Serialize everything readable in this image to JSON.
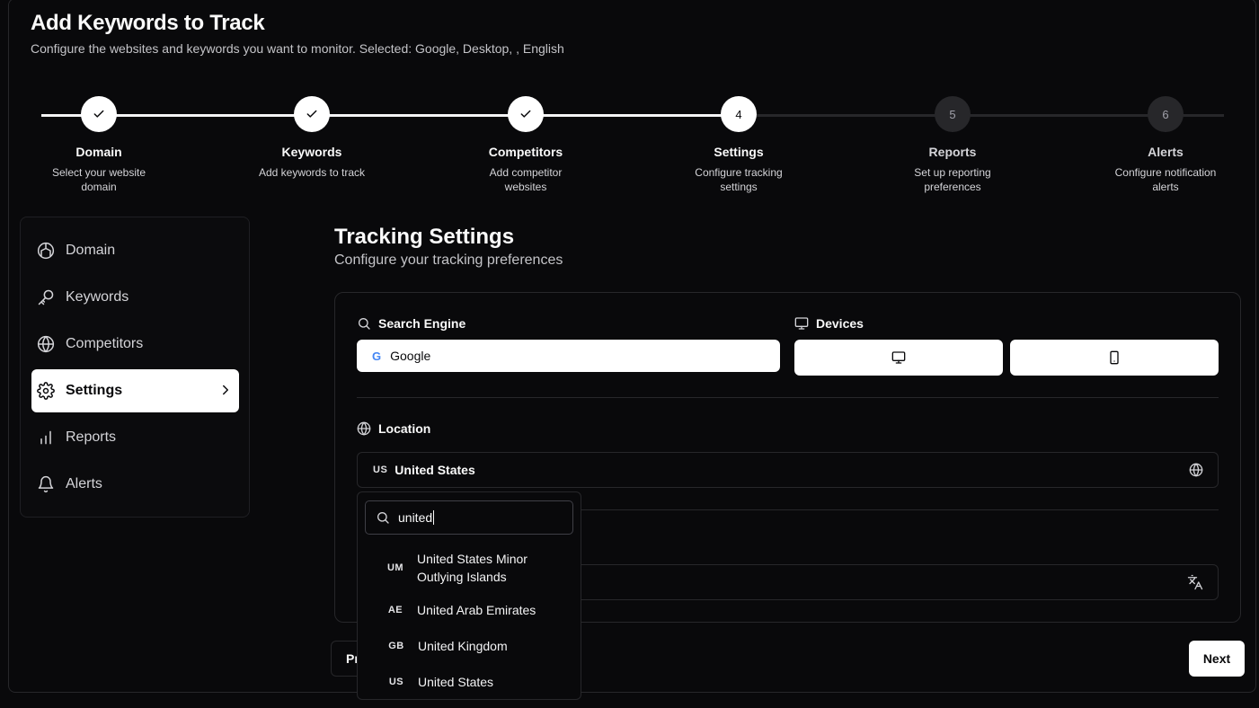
{
  "header": {
    "title": "Add Keywords to Track",
    "subtitle": "Configure the websites and keywords you want to monitor. Selected: Google, Desktop, , English"
  },
  "steps": [
    {
      "number": "1",
      "label": "Domain",
      "description": "Select your website domain",
      "state": "done"
    },
    {
      "number": "2",
      "label": "Keywords",
      "description": "Add keywords to track",
      "state": "done"
    },
    {
      "number": "3",
      "label": "Competitors",
      "description": "Add competitor websites",
      "state": "done"
    },
    {
      "number": "4",
      "label": "Settings",
      "description": "Configure tracking settings",
      "state": "current"
    },
    {
      "number": "5",
      "label": "Reports",
      "description": "Set up reporting preferences",
      "state": "todo"
    },
    {
      "number": "6",
      "label": "Alerts",
      "description": "Configure notification alerts",
      "state": "todo"
    }
  ],
  "sidebar": {
    "items": [
      {
        "label": "Domain",
        "icon": "domain-icon"
      },
      {
        "label": "Keywords",
        "icon": "key-icon"
      },
      {
        "label": "Competitors",
        "icon": "globe-icon"
      },
      {
        "label": "Settings",
        "icon": "gear-icon",
        "active": true
      },
      {
        "label": "Reports",
        "icon": "bar-chart-icon"
      },
      {
        "label": "Alerts",
        "icon": "bell-icon"
      }
    ]
  },
  "main": {
    "title": "Tracking Settings",
    "subtitle": "Configure your tracking preferences",
    "search_engine": {
      "label": "Search Engine",
      "value": "Google",
      "logo_letter": "G"
    },
    "devices": {
      "label": "Devices",
      "options": [
        "desktop-icon",
        "mobile-icon"
      ]
    },
    "location": {
      "label": "Location",
      "country_code": "US",
      "value": "United States"
    },
    "language": {
      "icon": "translate-icon"
    }
  },
  "dropdown": {
    "search_value": "united",
    "items": [
      {
        "code": "UM",
        "name_line1": "United States Minor",
        "name_line2": "Outlying Islands"
      },
      {
        "code": "AE",
        "name": "United Arab Emirates"
      },
      {
        "code": "GB",
        "name": "United Kingdom"
      },
      {
        "code": "US",
        "name": "United States"
      }
    ]
  },
  "footer": {
    "prev_label": "Pr",
    "next_label": "Next"
  },
  "colors": {
    "background": "#09090b",
    "border": "#27272a",
    "accent": "#ffffff",
    "muted": "#a1a1aa"
  }
}
